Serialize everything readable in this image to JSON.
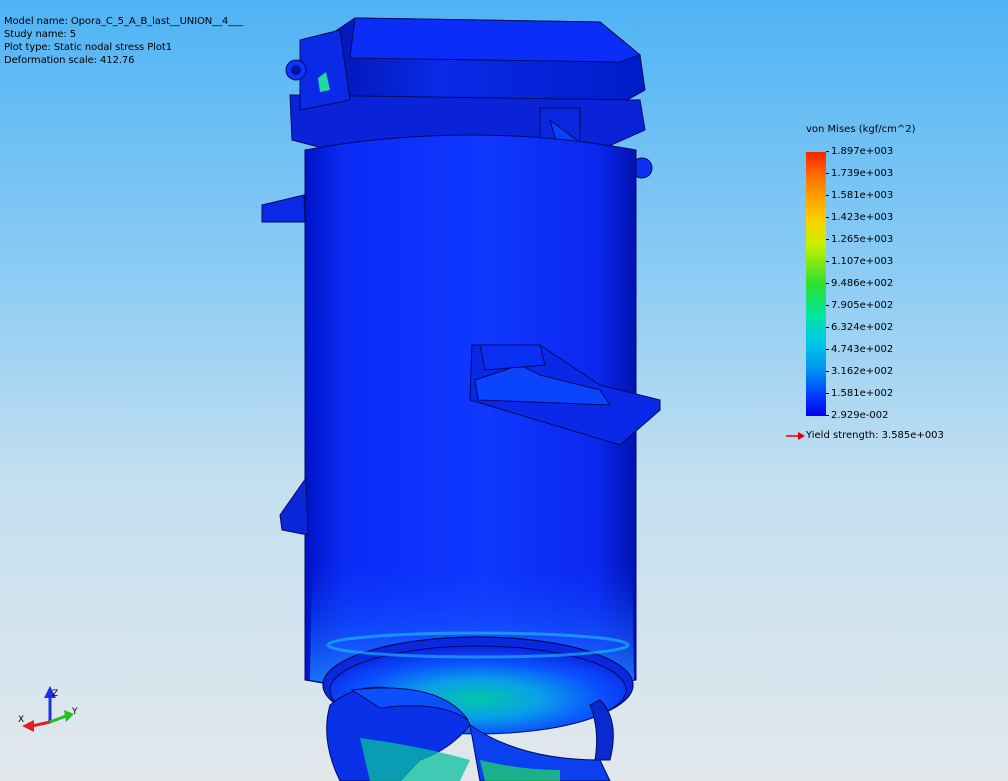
{
  "info": {
    "model_name": "Model name: Opora_C_5_A_B_last__UNION__4___",
    "study_name": "Study name: 5",
    "plot_type": "Plot type: Static nodal stress Plot1",
    "deformation_scale": "Deformation scale: 412.76"
  },
  "legend": {
    "title": "von Mises (kgf/cm^2)",
    "values": [
      "1.897e+003",
      "1.739e+003",
      "1.581e+003",
      "1.423e+003",
      "1.265e+003",
      "1.107e+003",
      "9.486e+002",
      "7.905e+002",
      "6.324e+002",
      "4.743e+002",
      "3.162e+002",
      "1.581e+002",
      "2.929e-002"
    ],
    "yield_strength": "Yield strength: 3.585e+003",
    "colors": {
      "max": "#ff2200",
      "min": "#0000e6",
      "yield_arrow": "#e00000"
    }
  },
  "triad": {
    "x": "X",
    "y": "Y",
    "z": "Z"
  },
  "colors": {
    "model_blue": "#0a24f0",
    "model_shadow": "#0012a0",
    "background_top": "#4fb3f4",
    "background_bottom": "#e2e8ec"
  }
}
